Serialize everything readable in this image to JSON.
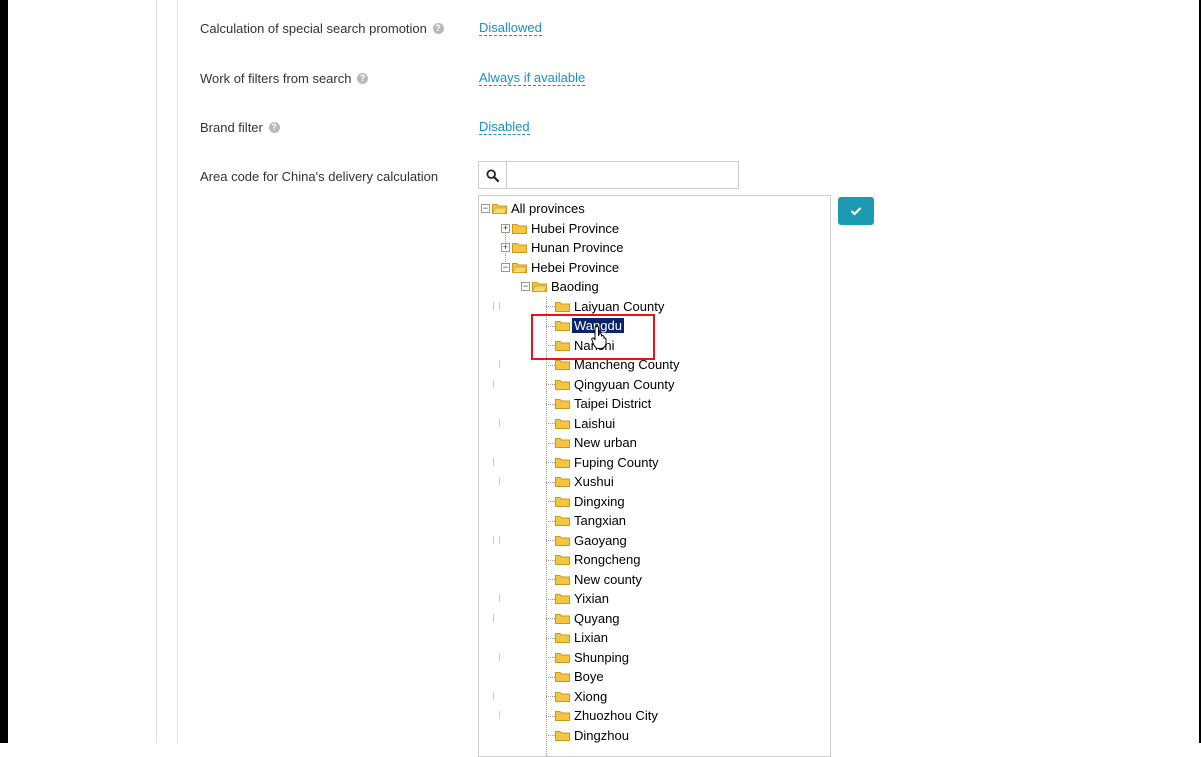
{
  "settings": [
    {
      "label": "Calculation of special search promotion",
      "value": "Disallowed"
    },
    {
      "label": "Work of filters from search",
      "value": "Always if available"
    },
    {
      "label": "Brand filter",
      "value": "Disabled"
    }
  ],
  "area_code": {
    "label": "Area code for China's delivery calculation",
    "search_value": "",
    "search_placeholder": ""
  },
  "tree": {
    "root": "All provinces",
    "provinces": [
      "Hubei Province",
      "Hunan Province",
      "Hebei Province"
    ],
    "city": "Baoding",
    "selected": "Wangdu",
    "counties": [
      "Laiyuan County",
      "Wangdu",
      "Nanshi",
      "Mancheng County",
      "Qingyuan County",
      "Taipei District",
      "Laishui",
      "New urban",
      "Fuping County",
      "Xushui",
      "Dingxing",
      "Tangxian",
      "Gaoyang",
      "Rongcheng",
      "New county",
      "Yixian",
      "Quyang",
      "Lixian",
      "Shunping",
      "Boye",
      "Xiong",
      "Zhuozhou City",
      "Dingzhou"
    ]
  },
  "icons": {
    "help": "question-circle-icon",
    "search": "search-icon",
    "confirm": "check-icon",
    "folder": "folder-icon"
  },
  "colors": {
    "link": "#1a8fc9",
    "confirm_button": "#1b9bb1",
    "selected_node": "#0a246a",
    "annotation": "#e8121b",
    "folder": "#f5c542"
  }
}
